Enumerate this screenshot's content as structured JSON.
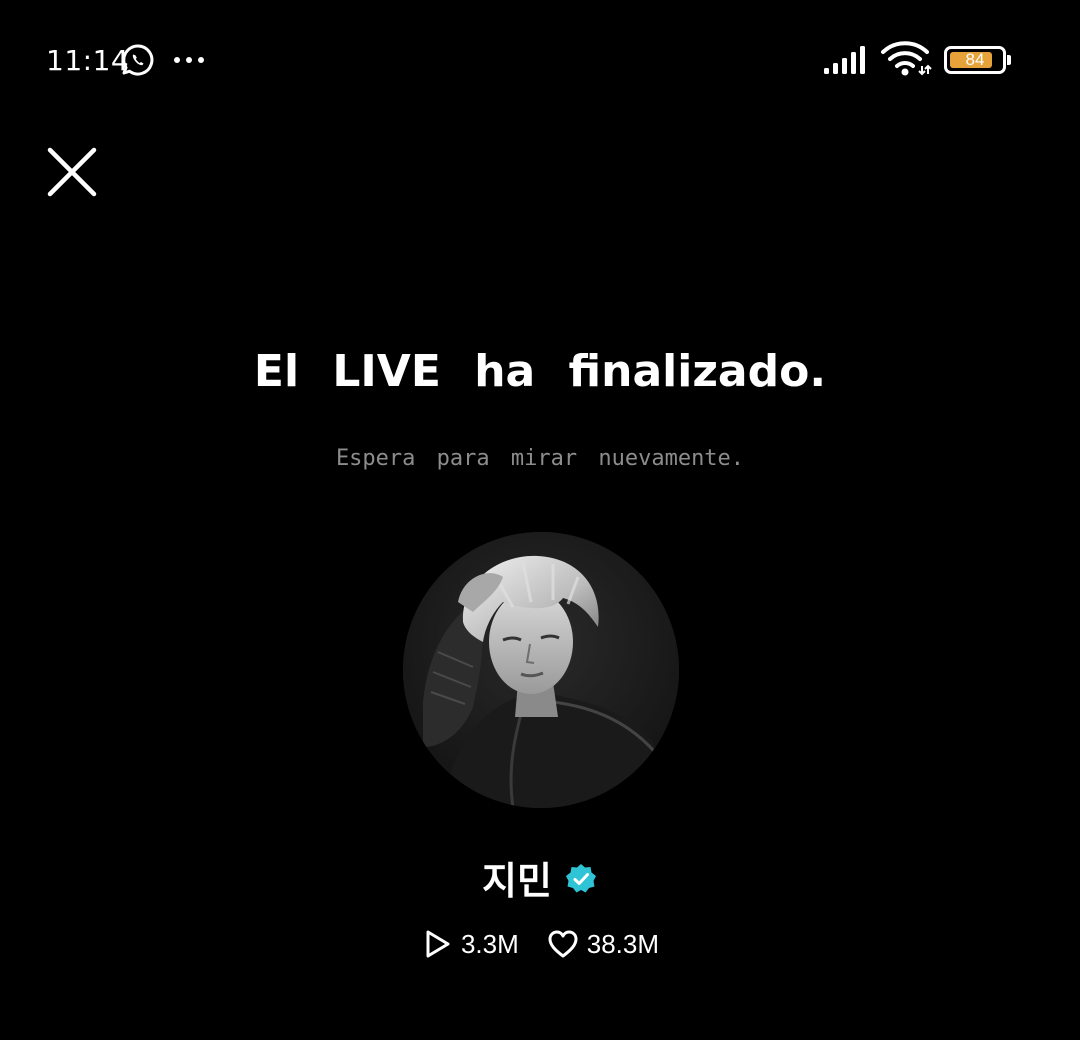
{
  "status_bar": {
    "time": "11:14",
    "battery_level": "84",
    "battery_percent": 84,
    "battery_color": "#e8a23a",
    "icons": [
      "whatsapp-icon",
      "more-icon",
      "signal-icon",
      "wifi-icon",
      "battery-icon"
    ]
  },
  "header": {
    "close_icon": "close-icon"
  },
  "message": {
    "title": "El LIVE ha finalizado.",
    "subtitle": "Espera para mirar nuevamente."
  },
  "profile": {
    "avatar_icon": "avatar",
    "name": "지민",
    "verified_icon": "verified-badge-icon",
    "verified_color": "#2ec4d6"
  },
  "stats": {
    "plays_icon": "play-icon",
    "plays": "3.3M",
    "likes_icon": "heart-icon",
    "likes": "38.3M"
  }
}
